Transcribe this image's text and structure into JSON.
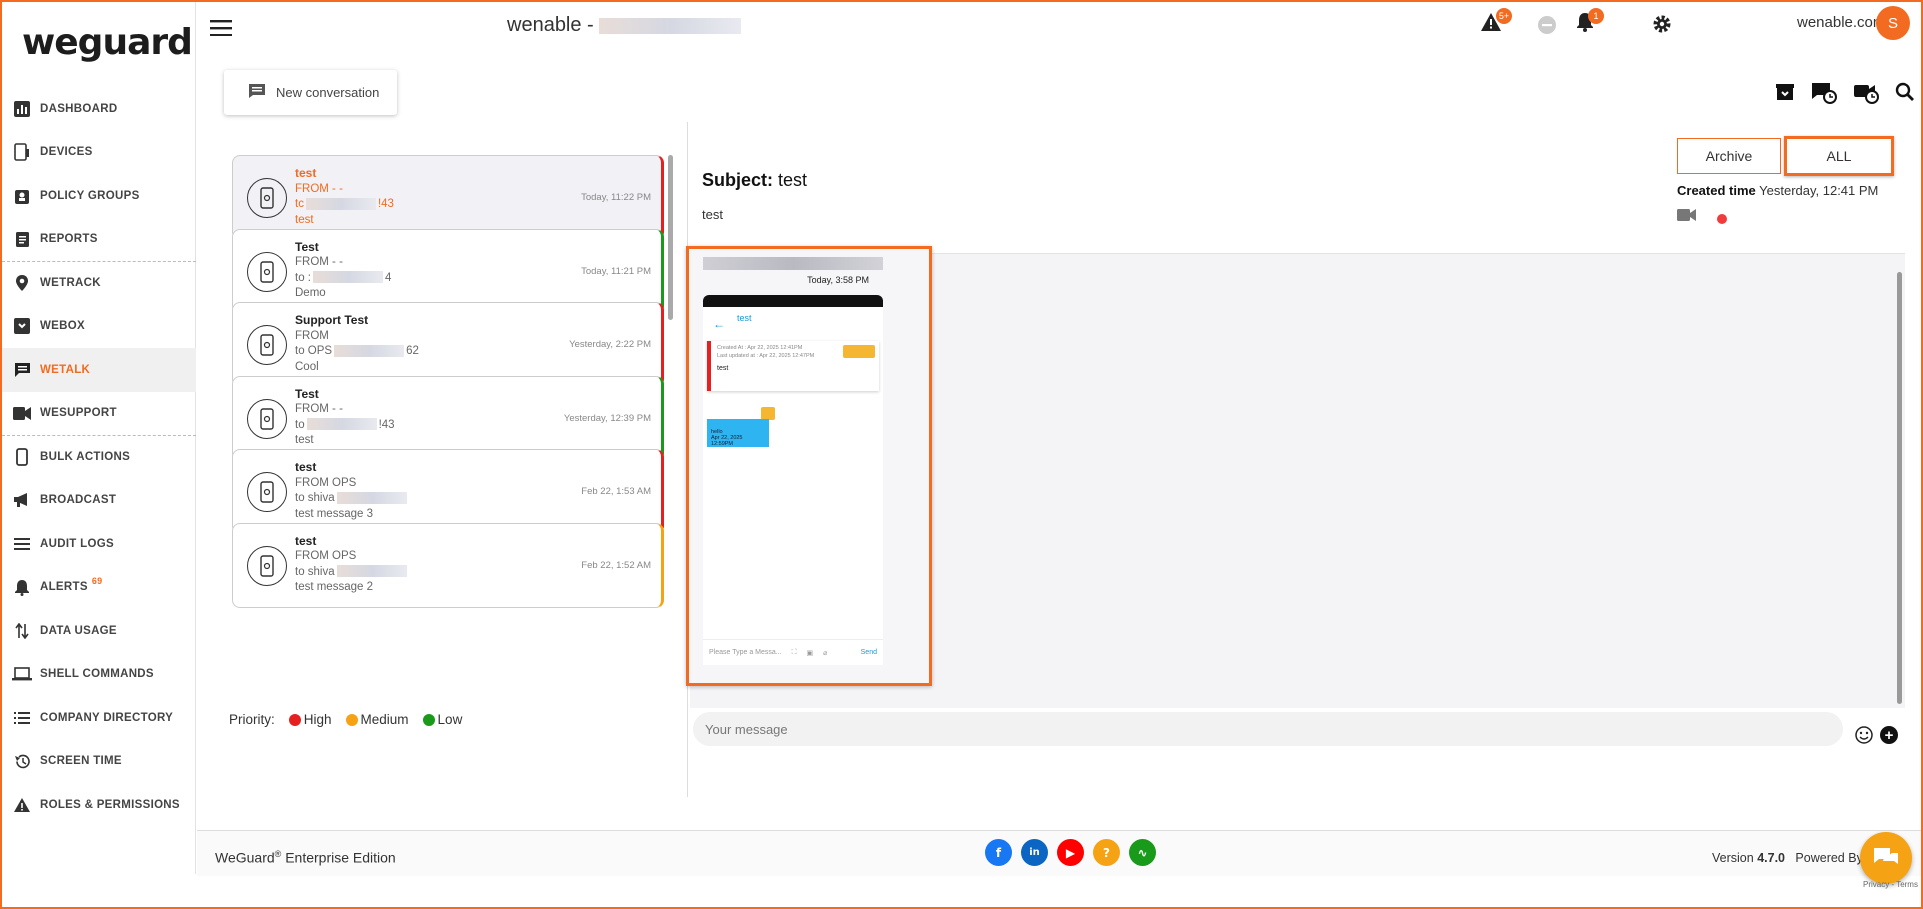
{
  "brand": {
    "logo": "weguard"
  },
  "sidebar": {
    "items": [
      {
        "label": "DASHBOARD",
        "icon": "bar-chart-icon"
      },
      {
        "label": "DEVICES",
        "icon": "devices-icon"
      },
      {
        "label": "POLICY GROUPS",
        "icon": "policy-icon"
      },
      {
        "label": "REPORTS",
        "icon": "report-icon"
      },
      {
        "label": "WETRACK",
        "icon": "location-pin-icon"
      },
      {
        "label": "WEBOX",
        "icon": "inbox-icon"
      },
      {
        "label": "WETALK",
        "icon": "chat-icon"
      },
      {
        "label": "WESUPPORT",
        "icon": "video-icon"
      },
      {
        "label": "BULK ACTIONS",
        "icon": "phone-icon"
      },
      {
        "label": "BROADCAST",
        "icon": "megaphone-icon"
      },
      {
        "label": "AUDIT LOGS",
        "icon": "list-icon"
      },
      {
        "label": "ALERTS",
        "icon": "bell-icon",
        "count": "69"
      },
      {
        "label": "DATA USAGE",
        "icon": "data-arrows-icon"
      },
      {
        "label": "SHELL COMMANDS",
        "icon": "laptop-icon"
      },
      {
        "label": "COMPANY DIRECTORY",
        "icon": "directory-icon"
      },
      {
        "label": "SCREEN TIME",
        "icon": "history-icon"
      },
      {
        "label": "ROLES & PERMISSIONS",
        "icon": "warning-icon"
      }
    ]
  },
  "header": {
    "title": "wenable -",
    "alert_badge": "5+",
    "bell_badge": "1",
    "user": "wenable.com",
    "avatar": "S"
  },
  "toolbar": {
    "new_conversation": "New conversation"
  },
  "conversations": [
    {
      "title": "test",
      "from": "FROM - -",
      "to": "tc",
      "to_suffix": "!43",
      "preview": "test",
      "time": "Today, 11:22 PM",
      "priority_color": "#e62020"
    },
    {
      "title": "Test",
      "from": "FROM - -",
      "to": "to :",
      "to_suffix": "4",
      "preview": "Demo",
      "time": "Today, 11:21 PM",
      "priority_color": "#1a9a1a"
    },
    {
      "title": "Support Test",
      "from": "FROM",
      "to": "to OPS",
      "to_suffix": "62",
      "preview": "Cool",
      "time": "Yesterday, 2:22 PM",
      "priority_color": "#e62020"
    },
    {
      "title": "Test",
      "from": "FROM - -",
      "to": "to",
      "to_suffix": "!43",
      "preview": "test",
      "time": "Yesterday, 12:39 PM",
      "priority_color": "#1a9a1a"
    },
    {
      "title": "test",
      "from": "FROM OPS",
      "to": "to shiva",
      "to_suffix": "",
      "preview": "test message 3",
      "time": "Feb 22, 1:53 AM",
      "priority_color": "#e62020"
    },
    {
      "title": "test",
      "from": "FROM OPS",
      "to": "to shiva",
      "to_suffix": "",
      "preview": "test message 2",
      "time": "Feb 22, 1:52 AM",
      "priority_color": "#f5a314"
    }
  ],
  "priority": {
    "label": "Priority:",
    "high": "High",
    "medium": "Medium",
    "low": "Low",
    "colors": {
      "high": "#e62020",
      "medium": "#f5a314",
      "low": "#1a9a1a"
    }
  },
  "detail": {
    "archive": "Archive",
    "all": "ALL",
    "created_label": "Created time",
    "created_value": "Yesterday, 12:41 PM",
    "subject_label": "Subject:",
    "subject": "test",
    "body": "test"
  },
  "message": {
    "time": "Today, 3:58 PM",
    "phone": {
      "title": "test",
      "created": "Created At : Apr 22, 2025 12:41PM",
      "updated": "Last updated at : Apr 22, 2025 12:47PM",
      "body": "test",
      "bubble_text": "hello",
      "bubble_time": "Apr 22, 2025 12:59PM",
      "placeholder": "Please Type a Messa...",
      "send": "Send"
    }
  },
  "composer": {
    "placeholder": "Your message"
  },
  "footer": {
    "brand": "WeGuard",
    "reg": "®",
    "edition": " Enterprise Edition",
    "version_label": "Version",
    "version": "4.7.0",
    "powered": "Powered By",
    "recaptcha": "Privacy - Terms"
  },
  "accent": "#f26b21"
}
